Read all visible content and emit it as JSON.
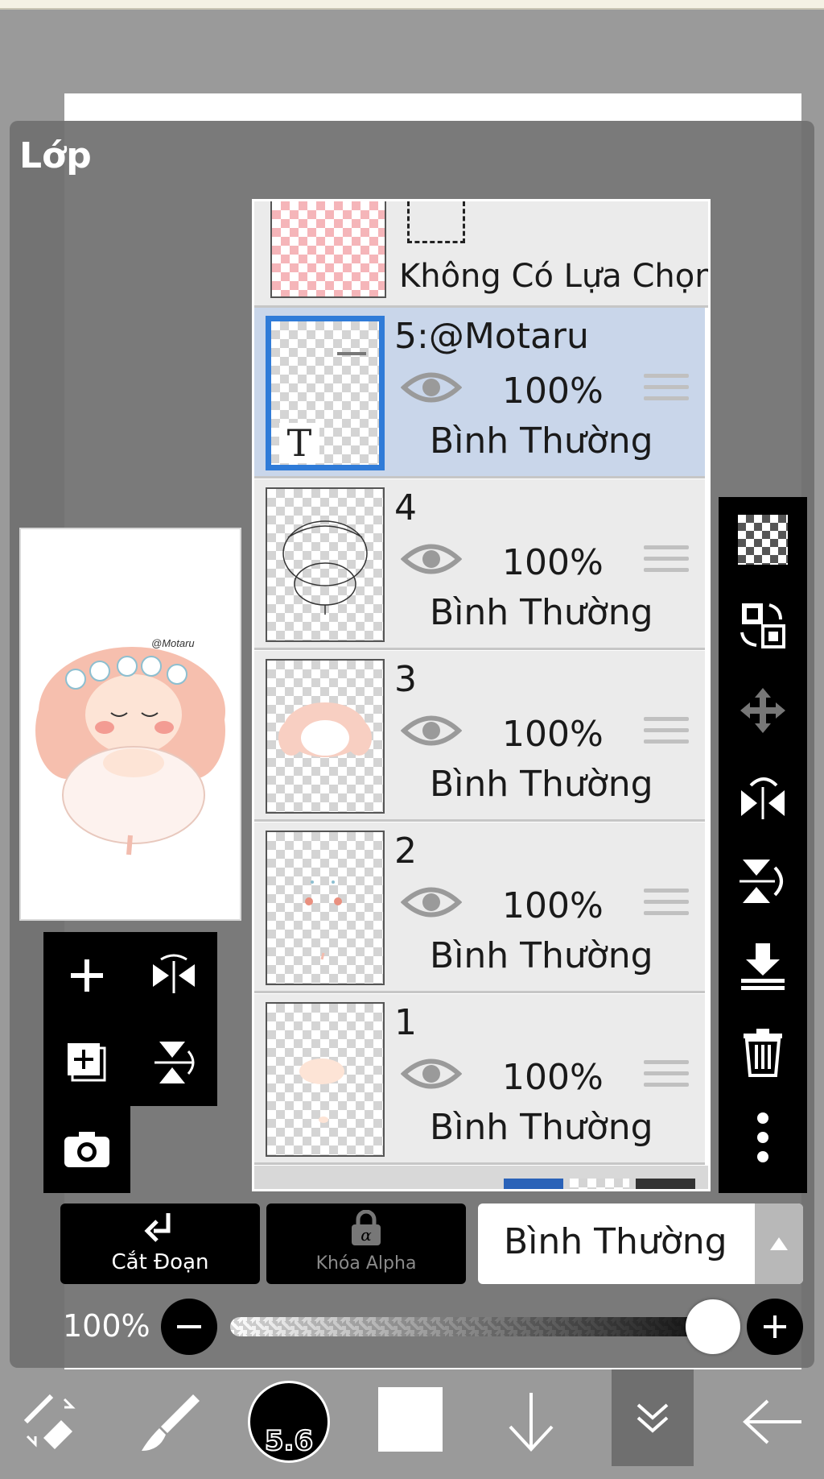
{
  "panel": {
    "title": "Lớp"
  },
  "selection_row": {
    "label": "Không Có Lựa Chọn"
  },
  "layers": [
    {
      "name": "5:@Motaru",
      "opacity": "100%",
      "blend": "Bình Thường",
      "selected": true,
      "type_badge": "T"
    },
    {
      "name": "4",
      "opacity": "100%",
      "blend": "Bình Thường",
      "selected": false
    },
    {
      "name": "3",
      "opacity": "100%",
      "blend": "Bình Thường",
      "selected": false
    },
    {
      "name": "2",
      "opacity": "100%",
      "blend": "Bình Thường",
      "selected": false
    },
    {
      "name": "1",
      "opacity": "100%",
      "blend": "Bình Thường",
      "selected": false
    }
  ],
  "preview": {
    "signature": "@Motaru"
  },
  "bottom_controls": {
    "clip_label": "Cắt Đoạn",
    "alpha_lock_label": "Khóa Alpha",
    "blend_mode_value": "Bình Thường",
    "opacity_label": "100%",
    "opacity_value": 1.0
  },
  "toolbar": {
    "brush_size": "5.6"
  },
  "colors": {
    "selected_blue": "#2f7bd8",
    "selected_row": "#c9d6ea",
    "panel_bg": "#7a7a7a",
    "toolbar_bg": "#000000"
  }
}
